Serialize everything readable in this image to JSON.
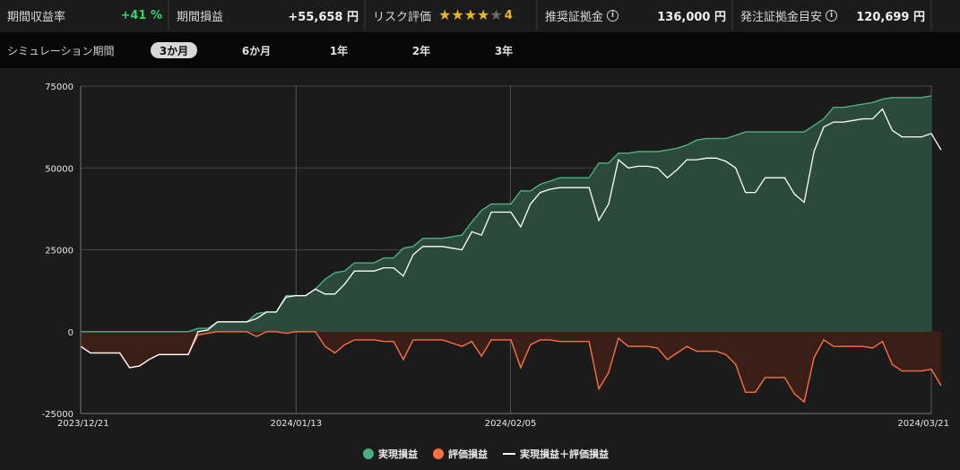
{
  "stats": {
    "return_label": "期間収益率",
    "return_value": "+41 %",
    "pl_label": "期間損益",
    "pl_value": "+55,658 円",
    "risk_label": "リスク評価",
    "risk_value": "4",
    "risk_stars": 4,
    "margin_label": "推奨証拠金",
    "margin_value": "136,000 円",
    "order_margin_label": "発注証拠金目安",
    "order_margin_value": "120,699 円",
    "info_icon": "i"
  },
  "period": {
    "label": "シミュレーション期間",
    "options": [
      "3か月",
      "6か月",
      "1年",
      "2年",
      "3年"
    ],
    "selected": "3か月"
  },
  "chart_data": {
    "type": "area",
    "x_ticks": [
      "2023/12/21",
      "2024/01/13",
      "2024/02/05",
      "2024/03/21"
    ],
    "y_ticks": [
      "75000",
      "50000",
      "25000",
      "0",
      "-25000"
    ],
    "ylim": [
      -25000,
      75000
    ],
    "grid": true,
    "legend_position": "bottom-center",
    "colors": {
      "realized": "#4caf80",
      "realized_fill": "#2c4a3c",
      "unrealized": "#ff6e40",
      "unrealized_fill": "#3a1f18",
      "total": "#ffffff"
    },
    "series": [
      {
        "name": "実現損益",
        "values": [
          0,
          0,
          0,
          0,
          0,
          0,
          0,
          0,
          0,
          0,
          0,
          0,
          1000,
          1000,
          3000,
          3000,
          3000,
          3000,
          5500,
          6000,
          6000,
          11000,
          11000,
          11000,
          13000,
          16000,
          18000,
          18500,
          21000,
          21000,
          21000,
          22500,
          22500,
          25500,
          26000,
          28500,
          28500,
          28500,
          29000,
          29500,
          33500,
          37000,
          39000,
          39000,
          39000,
          43000,
          43000,
          45000,
          46000,
          47000,
          47000,
          47000,
          47000,
          51500,
          51500,
          54500,
          54500,
          55000,
          55000,
          55000,
          55500,
          56000,
          57000,
          58500,
          59000,
          59000,
          59000,
          60000,
          61000,
          61000,
          61000,
          61000,
          61000,
          61000,
          61000,
          63000,
          65000,
          68500,
          68500,
          69000,
          69500,
          70000,
          71000,
          71500,
          71500,
          71500,
          71500,
          72000
        ]
      },
      {
        "name": "評価損益",
        "values": [
          -4500,
          -6500,
          -6500,
          -6500,
          -6500,
          -11000,
          -10500,
          -8500,
          -7000,
          -7000,
          -7000,
          -7000,
          -1000,
          -500,
          0,
          0,
          0,
          0,
          -1500,
          0,
          0,
          -500,
          0,
          0,
          0,
          -4500,
          -6500,
          -4000,
          -2500,
          -2500,
          -2500,
          -3000,
          -3000,
          -8500,
          -2500,
          -2500,
          -2500,
          -2500,
          -3500,
          -4500,
          -3000,
          -7500,
          -2500,
          -2500,
          -2500,
          -11000,
          -4000,
          -2500,
          -2500,
          -3000,
          -3000,
          -3000,
          -3000,
          -17500,
          -12500,
          -2000,
          -4500,
          -4500,
          -4500,
          -5000,
          -8500,
          -6500,
          -4500,
          -6000,
          -6000,
          -6000,
          -7000,
          -10000,
          -18500,
          -18500,
          -14000,
          -14000,
          -14000,
          -19000,
          -21500,
          -8000,
          -2500,
          -4500,
          -4500,
          -4500,
          -4500,
          -5000,
          -3000,
          -10000,
          -12000,
          -12000,
          -12000,
          -11500,
          -16500
        ]
      },
      {
        "name": "実現損益＋評価損益",
        "values": [
          -4500,
          -6500,
          -6500,
          -6500,
          -6500,
          -11000,
          -10500,
          -8500,
          -7000,
          -7000,
          -7000,
          -7000,
          0,
          500,
          3000,
          3000,
          3000,
          3000,
          4000,
          6000,
          6000,
          10500,
          11000,
          11000,
          13000,
          11500,
          11500,
          14500,
          18500,
          18500,
          18500,
          19500,
          19500,
          17000,
          23500,
          26000,
          26000,
          26000,
          25500,
          25000,
          30500,
          29500,
          36500,
          36500,
          36500,
          32000,
          39000,
          42500,
          43500,
          44000,
          44000,
          44000,
          44000,
          34000,
          39000,
          52500,
          50000,
          50500,
          50500,
          50000,
          47000,
          49500,
          52500,
          52500,
          53000,
          53000,
          52000,
          50000,
          42500,
          42500,
          47000,
          47000,
          47000,
          42000,
          39500,
          55000,
          62500,
          64000,
          64000,
          64500,
          65000,
          65000,
          68000,
          61500,
          59500,
          59500,
          59500,
          60500,
          55500
        ]
      }
    ]
  }
}
